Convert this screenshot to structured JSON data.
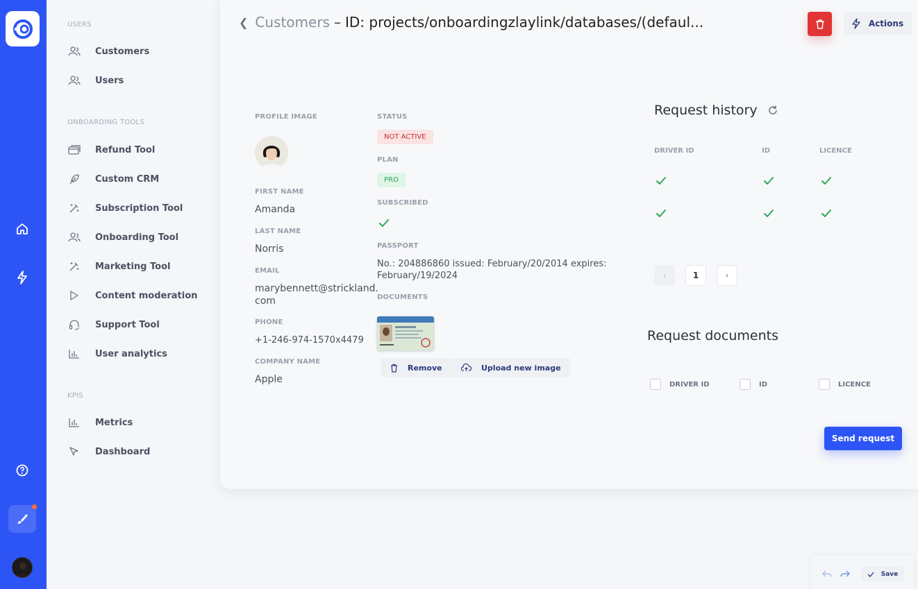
{
  "sidebar": {
    "sections": [
      {
        "title": "USERS",
        "items": [
          {
            "label": "Customers",
            "icon": "users-icon"
          },
          {
            "label": "Users",
            "icon": "users-icon"
          }
        ]
      },
      {
        "title": "ONBOARDING TOOLS",
        "items": [
          {
            "label": "Refund Tool",
            "icon": "card-icon"
          },
          {
            "label": "Custom CRM",
            "icon": "feather-icon"
          },
          {
            "label": "Subscription Tool",
            "icon": "wand-icon"
          },
          {
            "label": "Onboarding Tool",
            "icon": "users-icon"
          },
          {
            "label": "Marketing Tool",
            "icon": "wand-icon"
          },
          {
            "label": "Content moderation",
            "icon": "play-icon"
          },
          {
            "label": "Support Tool",
            "icon": "headset-icon"
          },
          {
            "label": "User analytics",
            "icon": "bar-chart-icon"
          }
        ]
      },
      {
        "title": "KPIS",
        "items": [
          {
            "label": "Metrics",
            "icon": "bar-chart-icon"
          },
          {
            "label": "Dashboard",
            "icon": "cursor-icon"
          }
        ]
      }
    ]
  },
  "header": {
    "crumb": "Customers",
    "separator": "–",
    "title": "ID: projects/onboardingzlaylink/databases/(defaul...",
    "actions_label": "Actions"
  },
  "profile": {
    "profile_image_label": "PROFILE IMAGE",
    "first_name_label": "FIRST NAME",
    "first_name": "Amanda",
    "last_name_label": "LAST NAME",
    "last_name": "Norris",
    "email_label": "EMAIL",
    "email_line1": "marybennett@strickland.",
    "email_line2": "com",
    "phone_label": "PHONE",
    "phone": "+1-246-974-1570x4479",
    "company_label": "COMPANY NAME",
    "company": "Apple"
  },
  "status": {
    "status_label": "STATUS",
    "status_value": "NOT ACTIVE",
    "plan_label": "PLAN",
    "plan_value": "PRO",
    "subscribed_label": "SUBSCRIBED",
    "subscribed": true,
    "passport_label": "PASSPORT",
    "passport_line1": "No.: 204886860 issued: February/20/2014 expires:",
    "passport_line2": "February/19/2024",
    "documents_label": "DOCUMENTS",
    "remove_label": "Remove",
    "upload_label": "Upload new image"
  },
  "request_history": {
    "title": "Request history",
    "columns": [
      "DRIVER ID",
      "ID",
      "LICENCE"
    ],
    "rows": [
      [
        true,
        true,
        true
      ],
      [
        true,
        true,
        true
      ]
    ],
    "current_page": "1"
  },
  "request_documents": {
    "title": "Request documents",
    "options": [
      "DRIVER ID",
      "ID",
      "LICENCE"
    ],
    "send_label": "Send request"
  },
  "save_bar": {
    "save_label": "Save"
  },
  "colors": {
    "accent": "#2d55f5",
    "danger": "#e13434",
    "success": "#2fa55e"
  }
}
